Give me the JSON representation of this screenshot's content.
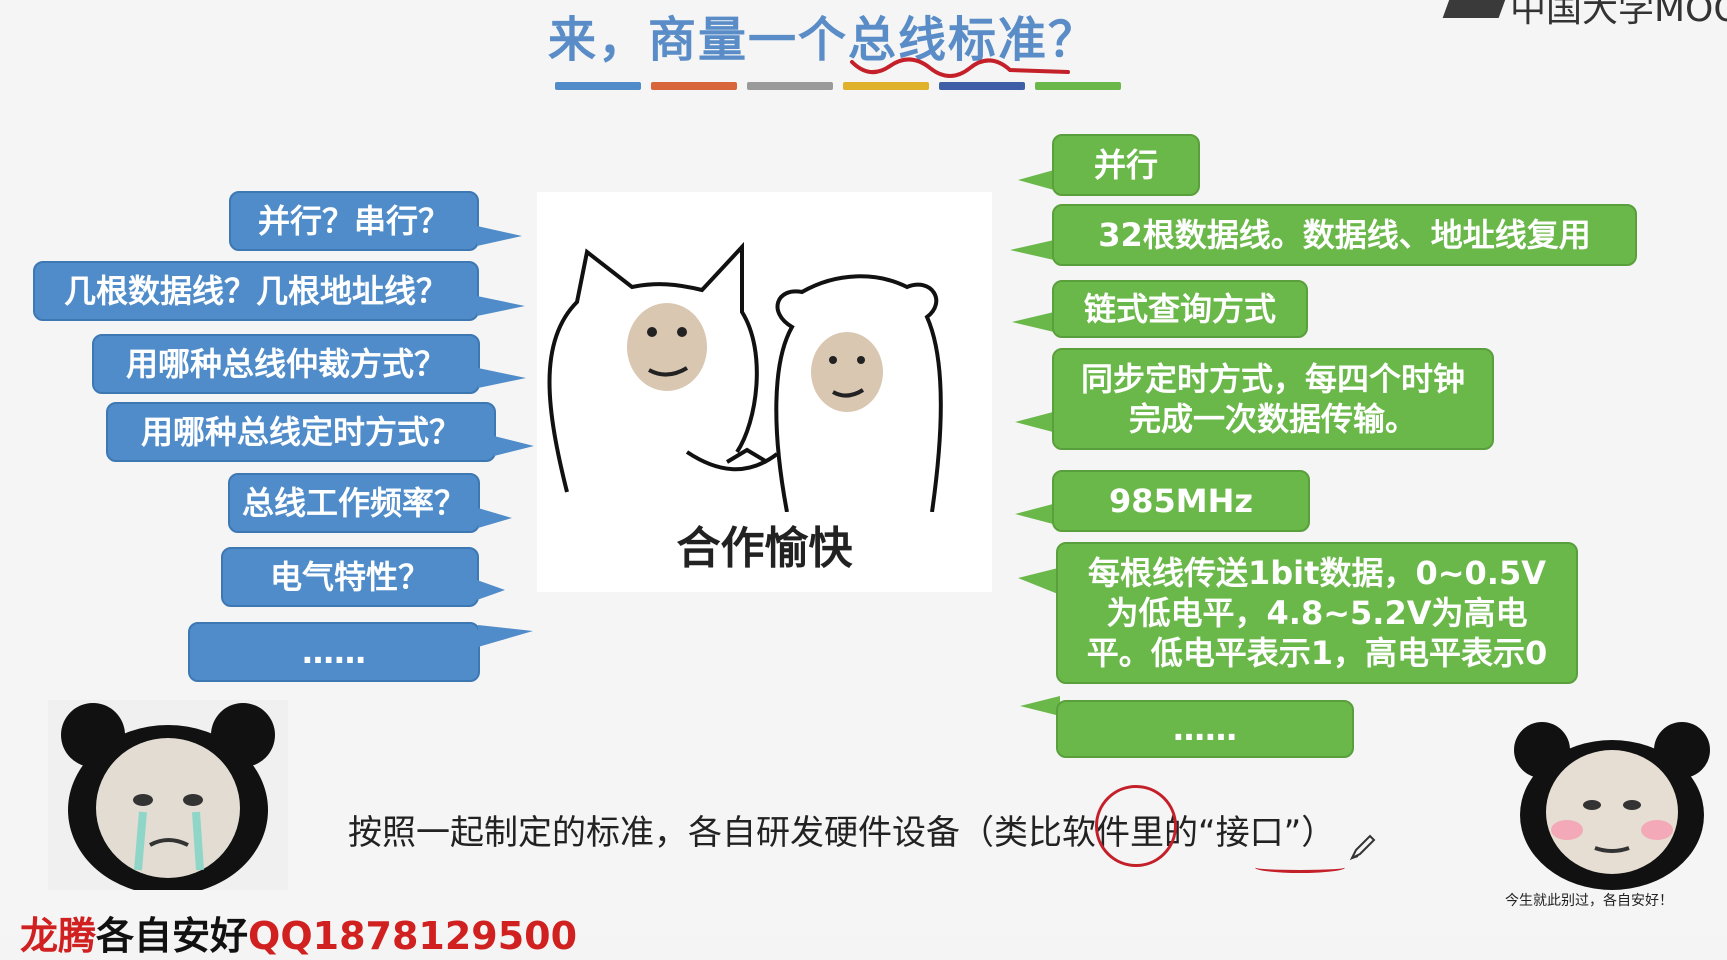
{
  "slide": {
    "title": "来，商量一个总线标准？",
    "title_bar_colors": [
      "#4f8cc9",
      "#d9663a",
      "#9a9a9a",
      "#e0b12b",
      "#3e5fa8",
      "#6bb84a"
    ],
    "logo_text": "中国大学MOOC",
    "center_caption": "合作愉快",
    "questions": [
      "并行？串行？",
      "几根数据线？几根地址线？",
      "用哪种总线仲裁方式？",
      "用哪种总线定时方式？",
      "总线工作频率？",
      "电气特性？",
      "……"
    ],
    "answers": [
      "并行",
      "32根数据线。数据线、地址线复用",
      "链式查询方式",
      "同步定时方式，每四个时钟完成一次数据传输。",
      "985MHz",
      "每根线传送1bit数据，0~0.5V为低电平，4.8~5.2V为高电平。低电平表示1，高电平表示0",
      "……"
    ],
    "bottom_text": "按照一起制定的标准，各自研发硬件设备（类比软件里的“接口”）",
    "panda_right_caption": "今生就此别过，各自安好！",
    "overlay_text_red1": "龙腾",
    "overlay_text_dark": "各自安好",
    "overlay_text_red2": "QQ1878129500"
  },
  "colors": {
    "blue_bubble": "#4f8cc9",
    "green_bubble": "#6bb84a",
    "title": "#5a8dc7",
    "annotation_red": "#c4202a"
  },
  "icons": {
    "pen": "pen-icon",
    "logo": "mooc-logo-icon"
  }
}
